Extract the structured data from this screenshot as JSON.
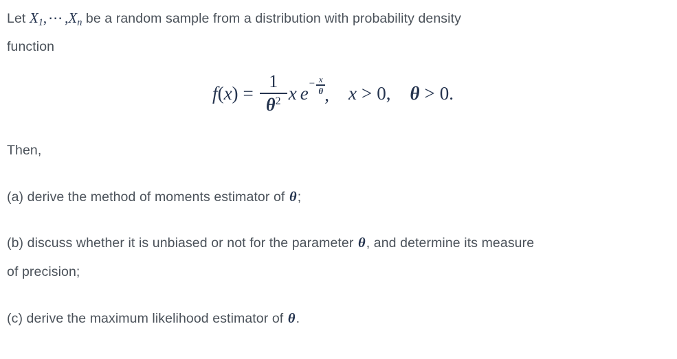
{
  "document": {
    "intro": {
      "line1_prefix": "Let ",
      "var_first": "X",
      "var_first_sub": "1",
      "comma_after_first": ",",
      "ellipsis": "⋯",
      "comma_before_last": ",",
      "var_last": "X",
      "var_last_sub": "n",
      "line1_suffix": " be a random sample from a distribution with probability density",
      "line2": "function"
    },
    "equation": {
      "lhs_f": "f",
      "lhs_open": "(",
      "lhs_var": "x",
      "lhs_close": ")",
      "equals": "=",
      "frac_numerator": "1",
      "frac_denominator_base": "θ",
      "frac_denominator_exp": "2",
      "factor_x": "x",
      "exp_base": "e",
      "exp_minus": "−",
      "exp_frac_num": "x",
      "exp_frac_den": "θ",
      "comma": ",",
      "cond1_var": "x",
      "cond1_op": ">",
      "cond1_val": "0,",
      "cond2_var": "θ",
      "cond2_op": ">",
      "cond2_val": "0.",
      "plain_text": "f(x) = (1/θ²) x e^(-x/θ),   x > 0,   θ > 0."
    },
    "then_label": "Then,",
    "parts": [
      {
        "id": "a",
        "line1_pre": "(a) derive the method of moments estimator of ",
        "symbol": "θ",
        "line1_post": ";"
      },
      {
        "id": "b",
        "line1_pre": "(b) discuss whether it is unbiased or not for the parameter ",
        "symbol": "θ",
        "line1_post": ", and determine its measure",
        "line2": "of precision;"
      },
      {
        "id": "c",
        "line1_pre": "(c) derive the maximum likelihood estimator of ",
        "symbol": "θ",
        "line1_post": "."
      }
    ],
    "colors": {
      "body_text": "#4a5159",
      "math_text": "#25344f",
      "background": "#ffffff"
    }
  }
}
